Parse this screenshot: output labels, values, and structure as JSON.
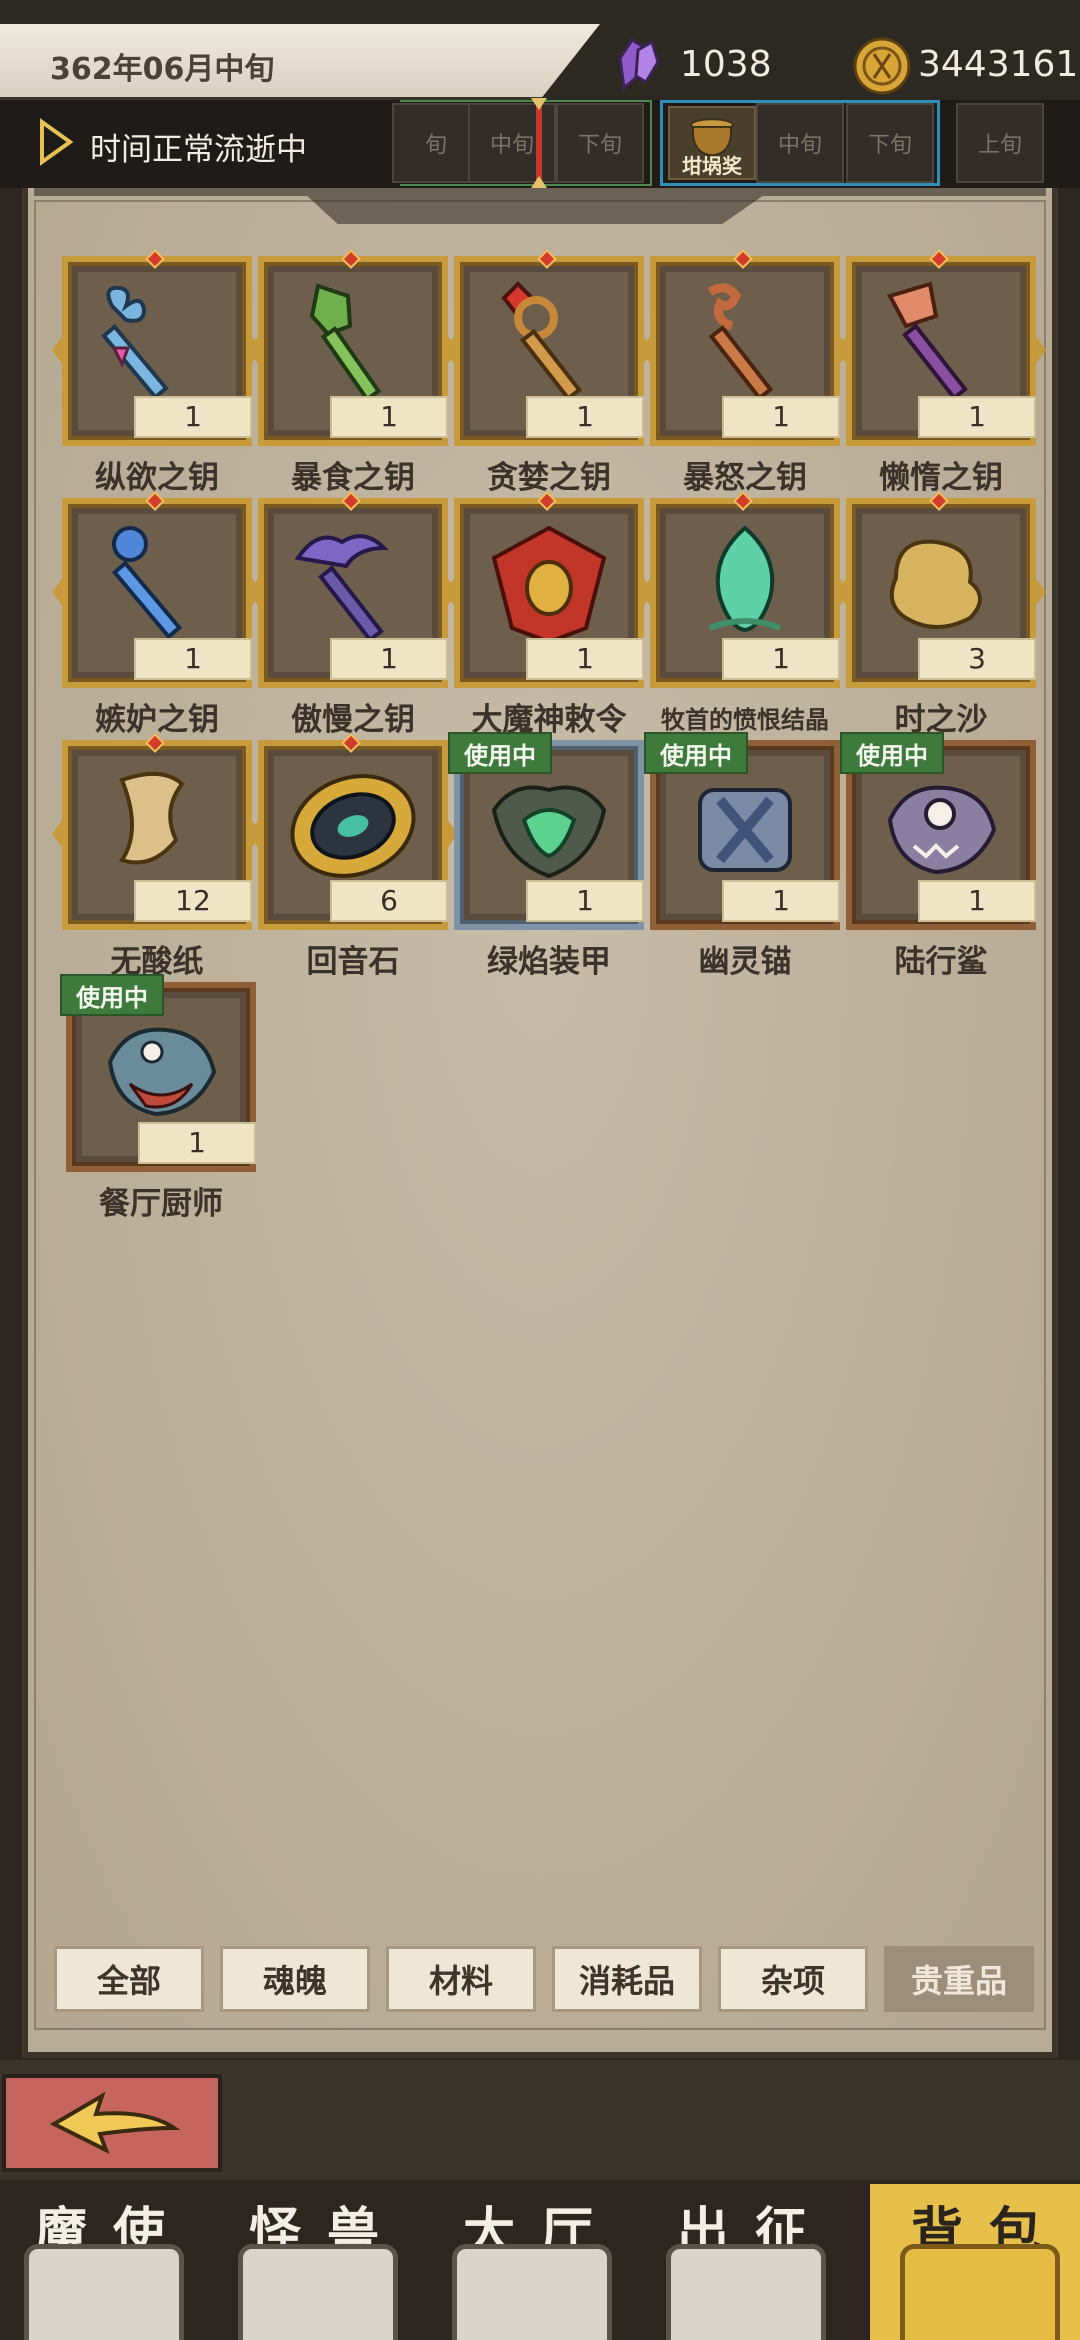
{
  "header": {
    "date": "362年06月中旬",
    "gems": "1038",
    "coins": "3443161"
  },
  "timeline": {
    "status": "时间正常流逝中",
    "segments": [
      "旬",
      "中旬",
      "下旬",
      "坩埚奖",
      "中旬",
      "下旬",
      "上旬"
    ]
  },
  "items": [
    {
      "name": "纵欲之钥",
      "count": "1"
    },
    {
      "name": "暴食之钥",
      "count": "1"
    },
    {
      "name": "贪婪之钥",
      "count": "1"
    },
    {
      "name": "暴怒之钥",
      "count": "1"
    },
    {
      "name": "懒惰之钥",
      "count": "1"
    },
    {
      "name": "嫉妒之钥",
      "count": "1"
    },
    {
      "name": "傲慢之钥",
      "count": "1"
    },
    {
      "name": "大魔神敕令",
      "count": "1"
    },
    {
      "name": "牧首的愤恨结晶",
      "count": "1"
    },
    {
      "name": "时之沙",
      "count": "3"
    },
    {
      "name": "无酸纸",
      "count": "12"
    },
    {
      "name": "回音石",
      "count": "6"
    },
    {
      "name": "绿焰装甲",
      "count": "1",
      "badge": "使用中"
    },
    {
      "name": "幽灵锚",
      "count": "1",
      "badge": "使用中"
    },
    {
      "name": "陆行鲨",
      "count": "1",
      "badge": "使用中"
    },
    {
      "name": "餐厅厨师",
      "count": "1",
      "badge": "使用中"
    }
  ],
  "tabs": [
    "全部",
    "魂魄",
    "材料",
    "消耗品",
    "杂项",
    "贵重品"
  ],
  "active_tab": "贵重品",
  "nav": [
    "魔使",
    "怪兽",
    "大厅",
    "出征",
    "背包"
  ],
  "active_nav": "背包",
  "icons": {
    "gem": "purple-crystal-icon",
    "coin": "gold-coin-icon",
    "play": "play-triangle-icon",
    "back": "back-arrow-icon"
  },
  "colors": {
    "badge_green": "#3f7a3d",
    "frame_gold": "#c79a3c",
    "back_button": "#c6655d",
    "nav_active": "#e6c04b"
  }
}
